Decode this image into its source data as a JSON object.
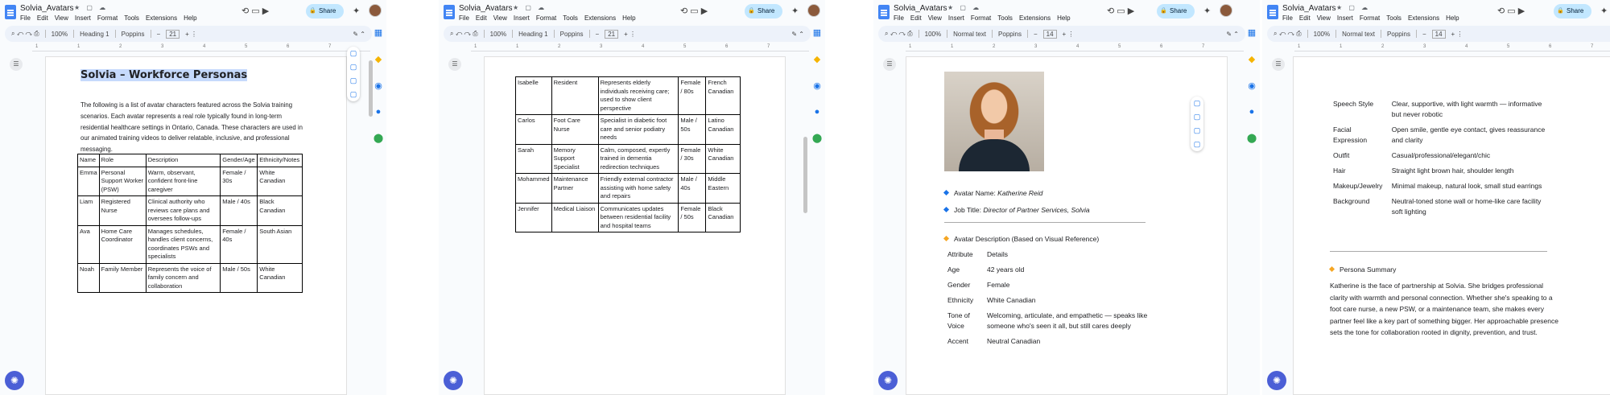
{
  "doc": {
    "title": "Solvia_Avatars",
    "menu": [
      "File",
      "Edit",
      "View",
      "Insert",
      "Format",
      "Tools",
      "Extensions",
      "Help"
    ],
    "share_label": "Share"
  },
  "toolbars": {
    "p1": {
      "zoom": "100%",
      "style": "Heading 1",
      "font": "Poppins",
      "size": "21"
    },
    "p2": {
      "zoom": "100%",
      "style": "Heading 1",
      "font": "Poppins",
      "size": "21"
    },
    "p3": {
      "zoom": "100%",
      "style": "Normal text",
      "font": "Poppins",
      "size": "14"
    },
    "p4": {
      "zoom": "100%",
      "style": "Normal text",
      "font": "Poppins",
      "size": "14"
    }
  },
  "ruler": [
    "1",
    "1",
    "2",
    "3",
    "4",
    "5",
    "6",
    "7"
  ],
  "page1": {
    "heading": "Solvia – Workforce Personas",
    "intro": "The following is a list of avatar characters featured across the Solvia training scenarios. Each avatar represents a real role typically found in long-term residential healthcare settings in Ontario, Canada. These characters are used in our animated training videos to deliver relatable, inclusive, and professional messaging.",
    "headers": [
      "Name",
      "Role",
      "Description",
      "Gender/Age",
      "Ethnicity/Notes"
    ],
    "rows": [
      [
        "Emma",
        "Personal Support Worker (PSW)",
        "Warm, observant, confident front-line caregiver",
        "Female / 30s",
        "White Canadian"
      ],
      [
        "Liam",
        "Registered Nurse",
        "Clinical authority who reviews care plans and oversees follow-ups",
        "Male / 40s",
        "Black Canadian"
      ],
      [
        "Ava",
        "Home Care Coordinator",
        "Manages schedules, handles client concerns, coordinates PSWs and specialists",
        "Female / 40s",
        "South Asian"
      ],
      [
        "Noah",
        "Family Member",
        "Represents the voice of family concern and collaboration",
        "Male / 50s",
        "White Canadian"
      ]
    ]
  },
  "page2": {
    "rows": [
      [
        "Isabelle",
        "Resident",
        "Represents elderly individuals receiving care; used to show client perspective",
        "Female / 80s",
        "French Canadian"
      ],
      [
        "Carlos",
        "Foot Care Nurse",
        "Specialist in diabetic foot care and senior podiatry needs",
        "Male / 50s",
        "Latino Canadian"
      ],
      [
        "Sarah",
        "Memory Support Specialist",
        "Calm, composed, expertly trained in dementia redirection techniques",
        "Female / 30s",
        "White Canadian"
      ],
      [
        "Mohammed",
        "Maintenance Partner",
        "Friendly external contractor assisting with home safety and repairs",
        "Male / 40s",
        "Middle Eastern"
      ],
      [
        "Jennifer",
        "Medical Liaison",
        "Communicates updates between residential facility and hospital teams",
        "Female / 50s",
        "Black Canadian"
      ]
    ]
  },
  "page3": {
    "name_label": "Avatar Name: ",
    "name_value": "Katherine Reid",
    "job_label": "Job Title: ",
    "job_value": "Director of Partner Services, Solvia",
    "desc_heading": "Avatar Description (Based on Visual Reference)",
    "attrs": [
      [
        "Attribute",
        "Details"
      ],
      [
        "Age",
        "42 years old"
      ],
      [
        "Gender",
        "Female"
      ],
      [
        "Ethnicity",
        "White Canadian"
      ],
      [
        "Tone of Voice",
        "Welcoming, articulate, and empathetic — speaks like someone who's seen it all, but still cares deeply"
      ],
      [
        "Accent",
        "Neutral Canadian"
      ]
    ]
  },
  "page4": {
    "attrs": [
      [
        "Speech Style",
        "Clear, supportive, with light warmth — informative but never robotic"
      ],
      [
        "Facial Expression",
        "Open smile, gentle eye contact, gives reassurance and clarity"
      ],
      [
        "Outfit",
        "Casual/professional/elegant/chic"
      ],
      [
        "Hair",
        "Straight light brown hair, shoulder length"
      ],
      [
        "Makeup/Jewelry",
        "Minimal makeup, natural look, small stud earrings"
      ],
      [
        "Background",
        "Neutral-toned stone wall or home-like care facility soft lighting"
      ]
    ],
    "summary_heading": "Persona Summary",
    "summary": "Katherine is the face of partnership at Solvia. She bridges professional clarity with warmth and personal connection. Whether she's speaking to a foot care nurse, a new PSW, or a maintenance team, she makes every partner feel like a key part of something bigger. Her approachable presence sets the tone for collaboration rooted in dignity, prevention, and trust."
  },
  "colors": {
    "accent": "#1a73e8",
    "share_bg": "#c2e7ff",
    "highlight": "#c6dafc",
    "bullet_orange": "#f5a623"
  }
}
